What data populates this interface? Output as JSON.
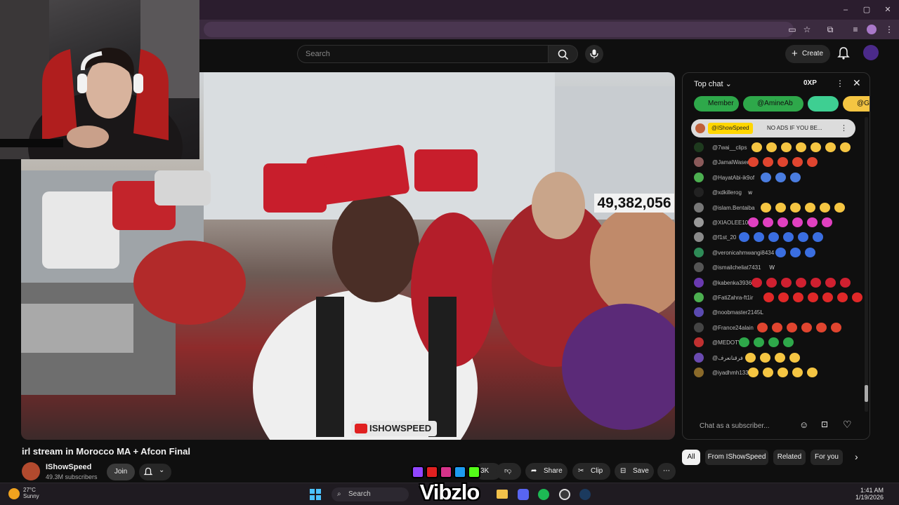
{
  "browser": {
    "window_controls": [
      "–",
      "▢",
      "✕"
    ]
  },
  "youtube_header": {
    "search_placeholder": "Search",
    "create_label": "Create"
  },
  "video": {
    "live_view_count": "49,382,056",
    "watermark": "ISHOWSPEED",
    "title": "irl stream in Morocco MA + Afcon Final"
  },
  "channel": {
    "name": "IShowSpeed",
    "subscribers": "49.3M subscribers",
    "join_label": "Join"
  },
  "actions": {
    "like_count": "3K",
    "share": "Share",
    "clip": "Clip",
    "save": "Save"
  },
  "chat": {
    "header": "Top chat",
    "xp": "0XP",
    "chips": [
      "Member",
      "@AmineAb",
      "@G"
    ],
    "pinned": {
      "user": "@IShowSpeed",
      "text": "NO ADS IF YOU BE..."
    },
    "messages": [
      {
        "user": "@7wai__clips",
        "emoji": 7,
        "emoji_color": "#f5c542",
        "avatar_color": "#1e3a1e"
      },
      {
        "user": "@JamalWasem",
        "emoji": 5,
        "emoji_color": "#e0452f",
        "avatar_color": "#8a5a5a"
      },
      {
        "user": "@HayatAbi-ik9of",
        "emoji": 3,
        "emoji_color": "#4a7de0",
        "avatar_color": "#4caf50"
      },
      {
        "user": "@xdkillerog",
        "text": "w",
        "avatar_color": "#222"
      },
      {
        "user": "@islam.Bentaiba",
        "emoji": 6,
        "emoji_color": "#f5c542",
        "avatar_color": "#777"
      },
      {
        "user": "@XIAOLEE104",
        "emoji": 6,
        "emoji_color": "#e040c0",
        "avatar_color": "#999"
      },
      {
        "user": "@f1st_20",
        "emoji": 6,
        "emoji_color": "#3a6ee0",
        "avatar_color": "#8a8a8a"
      },
      {
        "user": "@veronicahmwangi8434",
        "emoji": 3,
        "emoji_color": "#3a6ee0",
        "avatar_color": "#2e8b57"
      },
      {
        "user": "@ismailcheliat7431",
        "text": "W",
        "avatar_color": "#555"
      },
      {
        "user": "@kabenka3936",
        "emoji": 7,
        "emoji_color": "#d02030",
        "avatar_color": "#6a3ab0"
      },
      {
        "user": "@FatiZahra-ft1ir",
        "emoji": 7,
        "emoji_color": "#e02828",
        "avatar_color": "#4caf50"
      },
      {
        "user": "@noobmaster2145",
        "text": "L",
        "avatar_color": "#5a4ab0"
      },
      {
        "user": "@France24alain",
        "emoji": 6,
        "emoji_color": "#e0452f",
        "avatar_color": "#444"
      },
      {
        "user": "@MEDOTV5",
        "emoji": 4,
        "emoji_color": "#2ea84a",
        "avatar_color": "#c03030"
      },
      {
        "user": "@فرقنانعرف",
        "emoji": 4,
        "emoji_color": "#f5c542",
        "avatar_color": "#6a4ab0"
      },
      {
        "user": "@iyadhmh133",
        "emoji": 5,
        "emoji_color": "#f5c542",
        "avatar_color": "#8a6a2a"
      }
    ],
    "input_placeholder": "Chat as a subscriber..."
  },
  "tabs": [
    "All",
    "From IShowSpeed",
    "Related",
    "For you"
  ],
  "taskbar": {
    "temperature": "27°C",
    "weather": "Sunny",
    "search": "Search",
    "time": "1:41 AM",
    "date": "1/19/2026"
  },
  "overlay": {
    "brand": "Vibzlo"
  }
}
